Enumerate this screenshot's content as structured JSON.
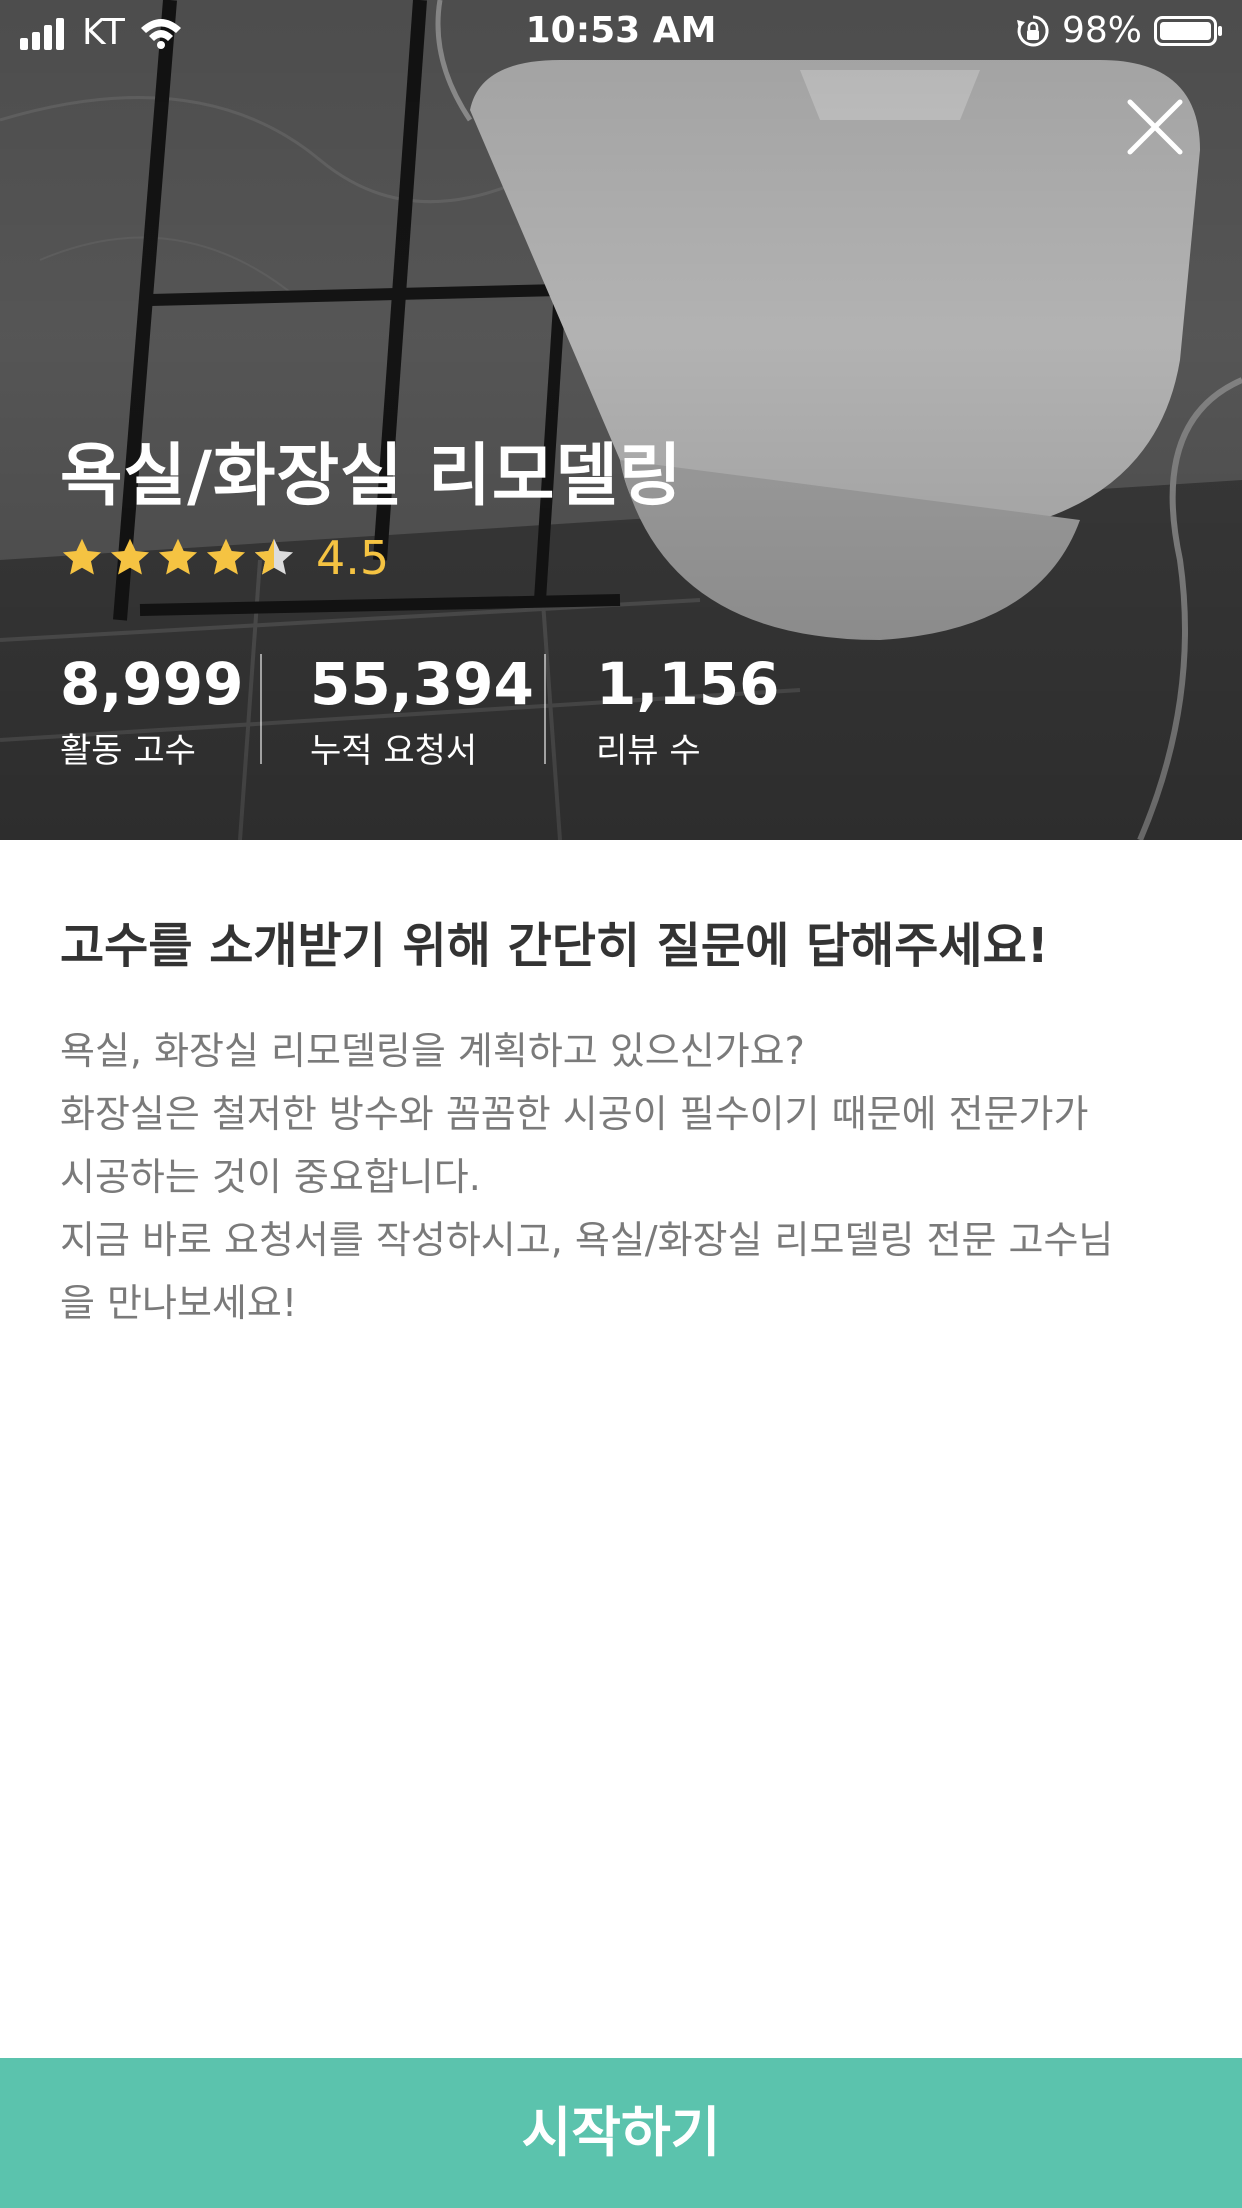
{
  "status_bar": {
    "carrier": "KT",
    "time": "10:53 AM",
    "battery": "98%",
    "icons": [
      "signal-icon",
      "wifi-icon",
      "lock-rotation-icon",
      "battery-icon"
    ]
  },
  "hero": {
    "title": "욕실/화장실 리모델링",
    "rating": 4.5,
    "rating_label": "4.5",
    "star_count": 5,
    "close_icon": "close-icon",
    "stats": [
      {
        "value": "8,999",
        "label": "활동 고수"
      },
      {
        "value": "55,394",
        "label": "누적 요청서"
      },
      {
        "value": "1,156",
        "label": "리뷰 수"
      }
    ]
  },
  "content": {
    "question_title": "고수를 소개받기 위해 간단히 질문에 답해주세요!",
    "description_lines": [
      "욕실, 화장실 리모델링을 계획하고 있으신가요?",
      "화장실은 철저한 방수와 꼼꼼한 시공이 필수이기 때문에 전문가가",
      "시공하는 것이 중요합니다.",
      "지금 바로 요청서를 작성하시고, 욕실/화장실 리모델링 전문 고수님",
      "을 만나보세요!"
    ]
  },
  "footer": {
    "start_label": "시작하기"
  },
  "colors": {
    "accent": "#5bc3ad",
    "star": "#f5c342",
    "title_text": "#333333",
    "body_text": "#7a7a7a"
  }
}
